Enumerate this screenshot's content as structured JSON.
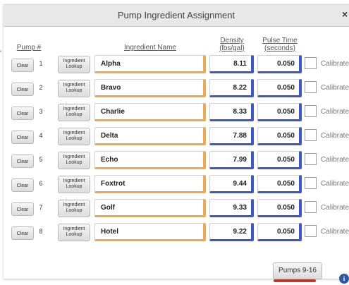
{
  "dialog": {
    "title": "Pump Ingredient Assignment",
    "close_glyph": "×"
  },
  "headers": {
    "pump": "Pump #",
    "ingredient_name": "Ingredient Name",
    "density_line1": "Density",
    "density_line2": "(lbs/gal)",
    "pulse_line1": "Pulse Time",
    "pulse_line2": "(seconds)"
  },
  "labels": {
    "clear": "Clear",
    "lookup_line1": "Ingredient",
    "lookup_line2": "Lookup",
    "calibrated": "Calibrated"
  },
  "rows": [
    {
      "pump": "1",
      "name": "Alpha",
      "density": "8.11",
      "pulse": "0.050"
    },
    {
      "pump": "2",
      "name": "Bravo",
      "density": "8.22",
      "pulse": "0.050"
    },
    {
      "pump": "3",
      "name": "Charlie",
      "density": "8.33",
      "pulse": "0.050"
    },
    {
      "pump": "4",
      "name": "Delta",
      "density": "7.88",
      "pulse": "0.050"
    },
    {
      "pump": "5",
      "name": "Echo",
      "density": "7.99",
      "pulse": "0.050"
    },
    {
      "pump": "6",
      "name": "Foxtrot",
      "density": "9.44",
      "pulse": "0.050"
    },
    {
      "pump": "7",
      "name": "Golf",
      "density": "9.33",
      "pulse": "0.050"
    },
    {
      "pump": "8",
      "name": "Hotel",
      "density": "9.22",
      "pulse": "0.050"
    }
  ],
  "footer": {
    "pumps_button": "Pumps 9-16",
    "info_glyph": "i"
  },
  "colors": {
    "name_accent": "#f0a84c",
    "number_accent": "#3d56c9",
    "info_icon": "#2d57a6"
  },
  "backdrop_mark": "'"
}
